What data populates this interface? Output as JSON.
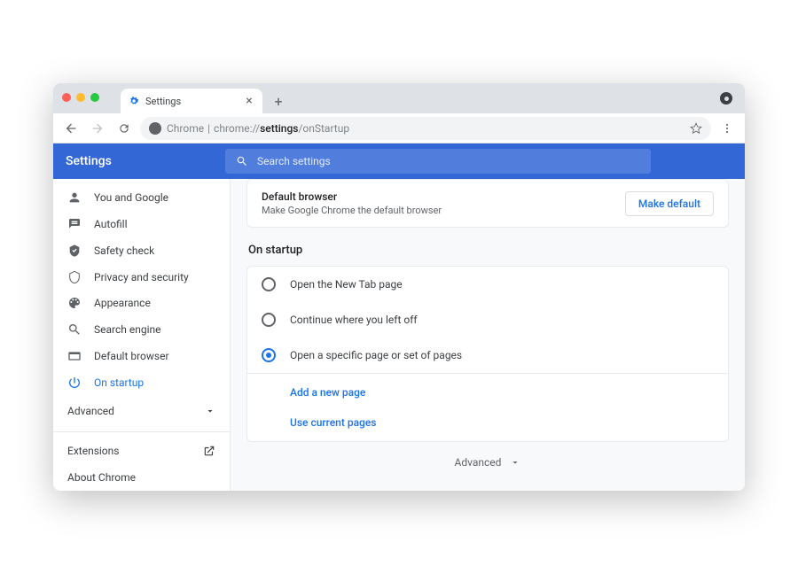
{
  "tab": {
    "title": "Settings"
  },
  "url": {
    "scheme": "Chrome",
    "rest1": "chrome://",
    "bold": "settings",
    "rest2": "/onStartup"
  },
  "header": {
    "title": "Settings",
    "search_placeholder": "Search settings"
  },
  "sidebar": {
    "items": [
      {
        "label": "You and Google"
      },
      {
        "label": "Autofill"
      },
      {
        "label": "Safety check"
      },
      {
        "label": "Privacy and security"
      },
      {
        "label": "Appearance"
      },
      {
        "label": "Search engine"
      },
      {
        "label": "Default browser"
      },
      {
        "label": "On startup"
      }
    ],
    "advanced_label": "Advanced",
    "extensions_label": "Extensions",
    "about_label": "About Chrome"
  },
  "main": {
    "default_browser": {
      "title": "Default browser",
      "subtitle": "Make Google Chrome the default browser",
      "button": "Make default"
    },
    "startup": {
      "section_title": "On startup",
      "options": [
        "Open the New Tab page",
        "Continue where you left off",
        "Open a specific page or set of pages"
      ],
      "add_page": "Add a new page",
      "use_current": "Use current pages"
    },
    "advanced_label": "Advanced"
  }
}
